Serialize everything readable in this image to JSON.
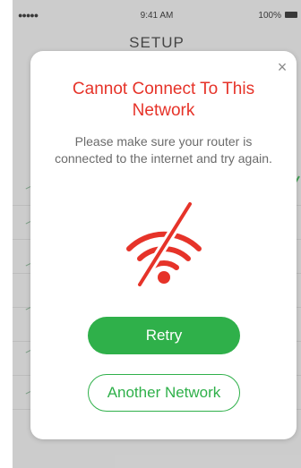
{
  "status_bar": {
    "signal": "●●●●● ",
    "time": "9:41 AM",
    "battery": "100%"
  },
  "screen": {
    "title": "SETUP",
    "list_icons": [
      "wifi-icon",
      "wifi-icon",
      "wifi-icon",
      "wifi-icon",
      "wifi-icon",
      "wifi-icon"
    ]
  },
  "modal": {
    "close_label": "×",
    "title": "Cannot Connect To This Network",
    "message": "Please make sure your router is connected to the internet and try again.",
    "icon": "wifi-off-icon",
    "retry_label": "Retry",
    "another_label": "Another Network"
  },
  "colors": {
    "error": "#e63329",
    "primary": "#2fb04a",
    "text_muted": "#6b6b6b"
  }
}
